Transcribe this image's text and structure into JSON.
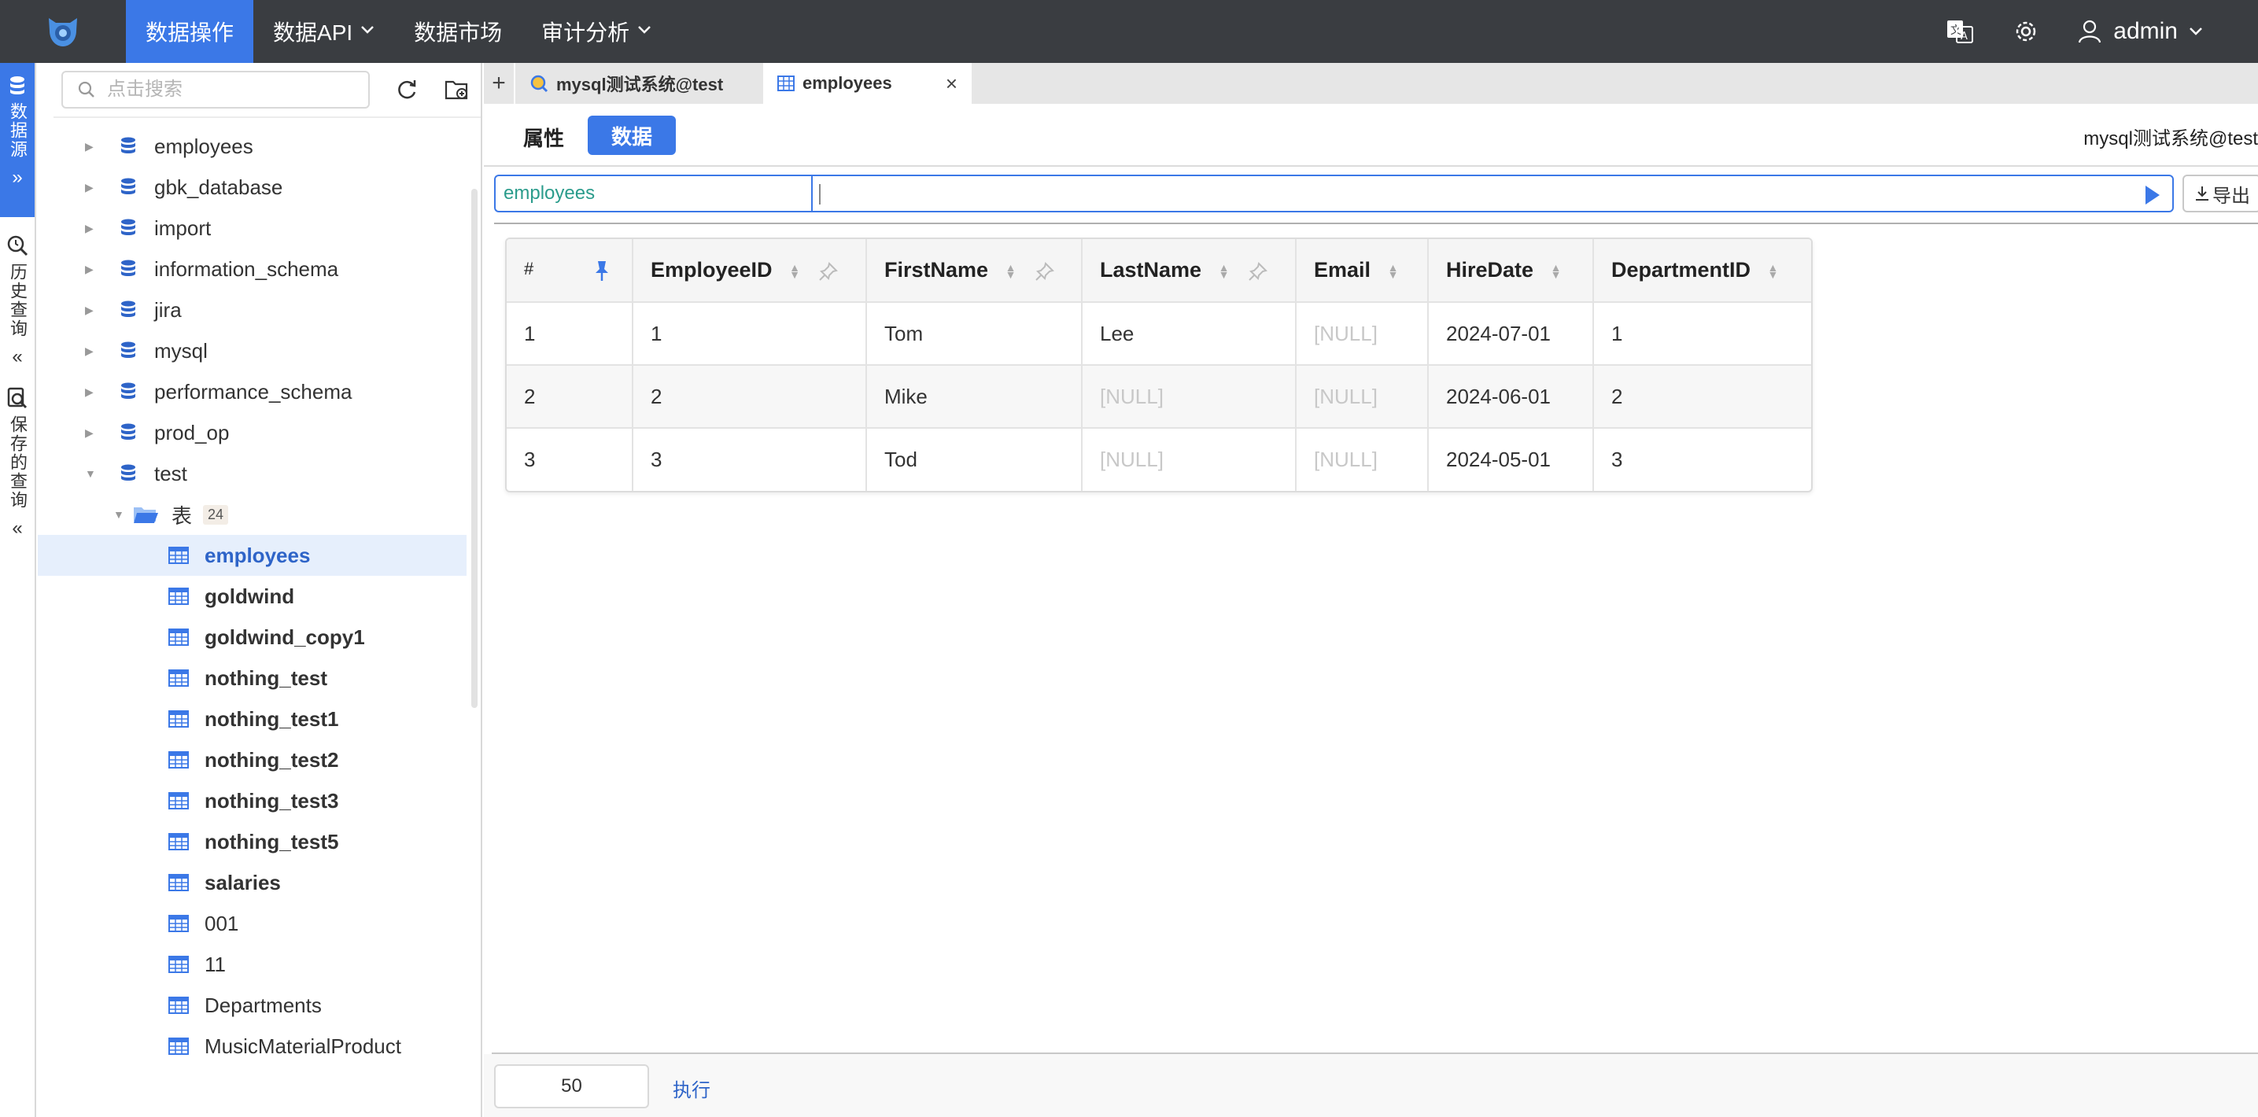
{
  "topbar": {
    "nav": [
      {
        "label": "数据操作",
        "active": true,
        "dropdown": false
      },
      {
        "label": "数据API",
        "active": false,
        "dropdown": true
      },
      {
        "label": "数据市场",
        "active": false,
        "dropdown": false
      },
      {
        "label": "审计分析",
        "active": false,
        "dropdown": true
      }
    ],
    "user": "admin"
  },
  "rail": {
    "datasource": "数据源",
    "history": "历史查询",
    "saved": "保存的查询"
  },
  "sidebar": {
    "search_placeholder": "点击搜索",
    "databases": [
      "employees",
      "gbk_database",
      "import",
      "information_schema",
      "jira",
      "mysql",
      "performance_schema",
      "prod_op",
      "test"
    ],
    "folder": {
      "label": "表",
      "count": "24"
    },
    "tables": [
      {
        "name": "employees",
        "bold": true,
        "selected": true
      },
      {
        "name": "goldwind",
        "bold": true
      },
      {
        "name": "goldwind_copy1",
        "bold": true
      },
      {
        "name": "nothing_test",
        "bold": true
      },
      {
        "name": "nothing_test1",
        "bold": true
      },
      {
        "name": "nothing_test2",
        "bold": true
      },
      {
        "name": "nothing_test3",
        "bold": true
      },
      {
        "name": "nothing_test5",
        "bold": true
      },
      {
        "name": "salaries",
        "bold": true
      },
      {
        "name": "001",
        "bold": false
      },
      {
        "name": "11",
        "bold": false
      },
      {
        "name": "Departments",
        "bold": false
      },
      {
        "name": "MusicMaterialProduct",
        "bold": false
      }
    ]
  },
  "tabs": {
    "add": "+",
    "items": [
      {
        "label": "mysql测试系统@test",
        "active": false
      },
      {
        "label": "employees",
        "active": true,
        "close": "×"
      }
    ]
  },
  "subtabs": {
    "attributes": "属性",
    "data": "数据",
    "connection": "mysql测试系统@test"
  },
  "query": {
    "table": "employees",
    "value": "",
    "export": "导出"
  },
  "grid": {
    "columns": [
      "#",
      "EmployeeID",
      "FirstName",
      "LastName",
      "Email",
      "HireDate",
      "DepartmentID"
    ],
    "rows": [
      [
        "1",
        "1",
        "Tom",
        "Lee",
        "[NULL]",
        "2024-07-01",
        "1"
      ],
      [
        "2",
        "2",
        "Mike",
        "[NULL]",
        "[NULL]",
        "2024-06-01",
        "2"
      ],
      [
        "3",
        "3",
        "Tod",
        "[NULL]",
        "[NULL]",
        "2024-05-01",
        "3"
      ]
    ]
  },
  "footer": {
    "limit": "50",
    "execute": "执行"
  },
  "colors": {
    "accent": "#3b78e7",
    "topbar": "#3a3d41",
    "null_text": "#c8c8c8"
  }
}
